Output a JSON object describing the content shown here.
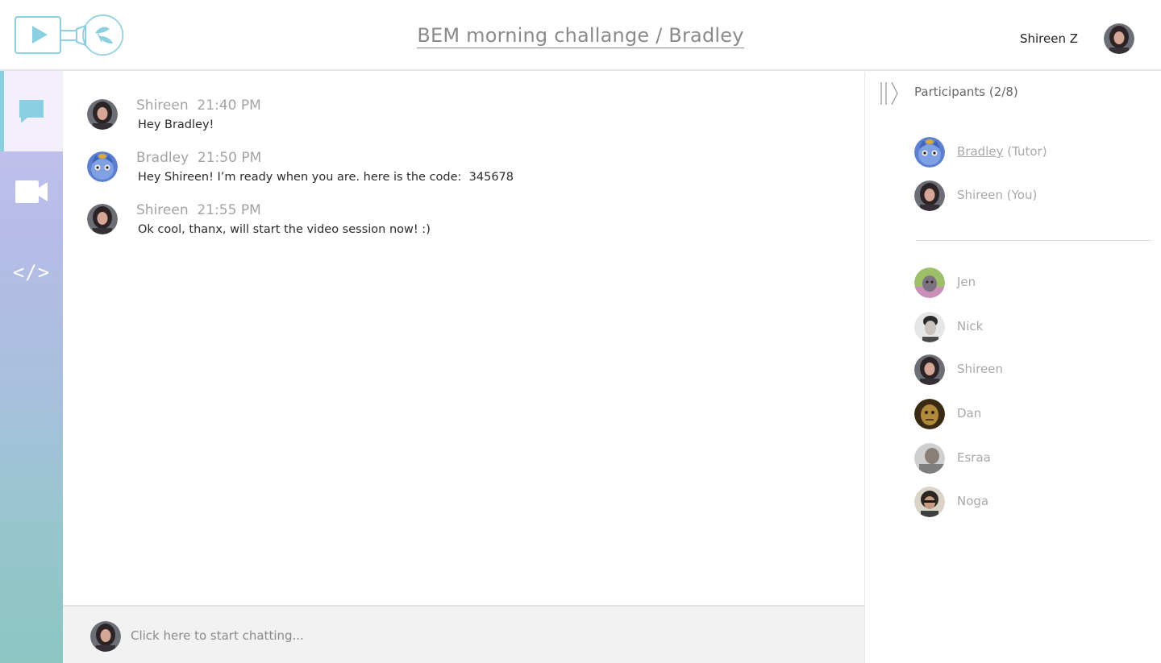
{
  "header": {
    "title": "BEM morning challange / Bradley",
    "user_name": "Shireen Z",
    "logo_icon": "video-leaf-logo-icon"
  },
  "sidebar": {
    "items": [
      {
        "icon": "chat-bubble-icon",
        "active": true
      },
      {
        "icon": "video-camera-icon",
        "active": false
      },
      {
        "icon": "code-icon",
        "glyph": "</>",
        "active": false
      }
    ]
  },
  "chat": {
    "messages": [
      {
        "author": "Shireen",
        "time": "21:40 PM",
        "text": "Hey Bradley!"
      },
      {
        "author": "Bradley",
        "time": "21:50 PM",
        "text": "Hey Shireen! I’m ready when you are. here is the code:  345678"
      },
      {
        "author": "Shireen",
        "time": "21:55 PM",
        "text": "Ok cool, thanx, will start the video session now! :)"
      }
    ]
  },
  "composer": {
    "placeholder": "Click here to start chatting..."
  },
  "participants": {
    "title": "Participants (2/8)",
    "active": [
      {
        "name": "Bradley",
        "suffix": " (Tutor)"
      },
      {
        "name": "Shireen (You)"
      }
    ],
    "others": [
      "Jen",
      "Nick",
      "Shireen",
      "Dan",
      "Esraa",
      "Noga"
    ]
  },
  "colors": {
    "accent": "#8bd0e2",
    "sidebar_top": "#c9c6ef",
    "sidebar_bottom": "#8cc6c3"
  }
}
